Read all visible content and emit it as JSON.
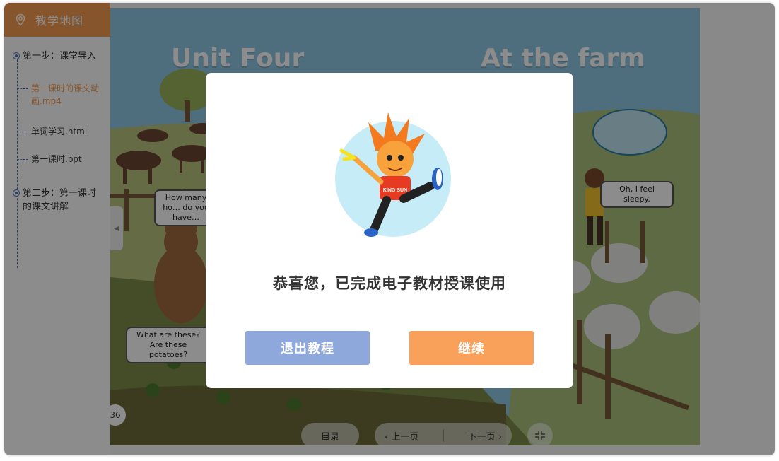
{
  "sidebar": {
    "title": "教学地图",
    "steps": [
      {
        "label": "第一步：课堂导入"
      },
      {
        "label": "第二步：第一课时的课文讲解"
      }
    ],
    "items": [
      {
        "label": "第一课时的课文动画.mp4",
        "active": true
      },
      {
        "label": "单词学习.html",
        "active": false
      },
      {
        "label": "第一课时.ppt",
        "active": false
      }
    ],
    "collapse_icon": "chevron-left-icon"
  },
  "page": {
    "title_left": "Unit Four",
    "title_right": "At the farm",
    "bubbles": {
      "horses": "How many ho… do you have…",
      "sleepy": "Oh, I feel sleepy.",
      "potatoes": "What are these? Are these potatoes?"
    },
    "page_number": "36"
  },
  "bottom_nav": {
    "menu_label": "目录",
    "prev_label": "上一页",
    "next_label": "下一页",
    "zoom_icon": "collapse-icon"
  },
  "modal": {
    "message": "恭喜您，已完成电子教材授课使用",
    "exit_label": "退出教程",
    "continue_label": "继续",
    "mascot_text": "KING SUN"
  },
  "colors": {
    "accent_orange": "#f69b4f",
    "exit_button": "#8fa8db",
    "continue_button": "#f9a05a",
    "tree_line": "#4a6fb1"
  }
}
